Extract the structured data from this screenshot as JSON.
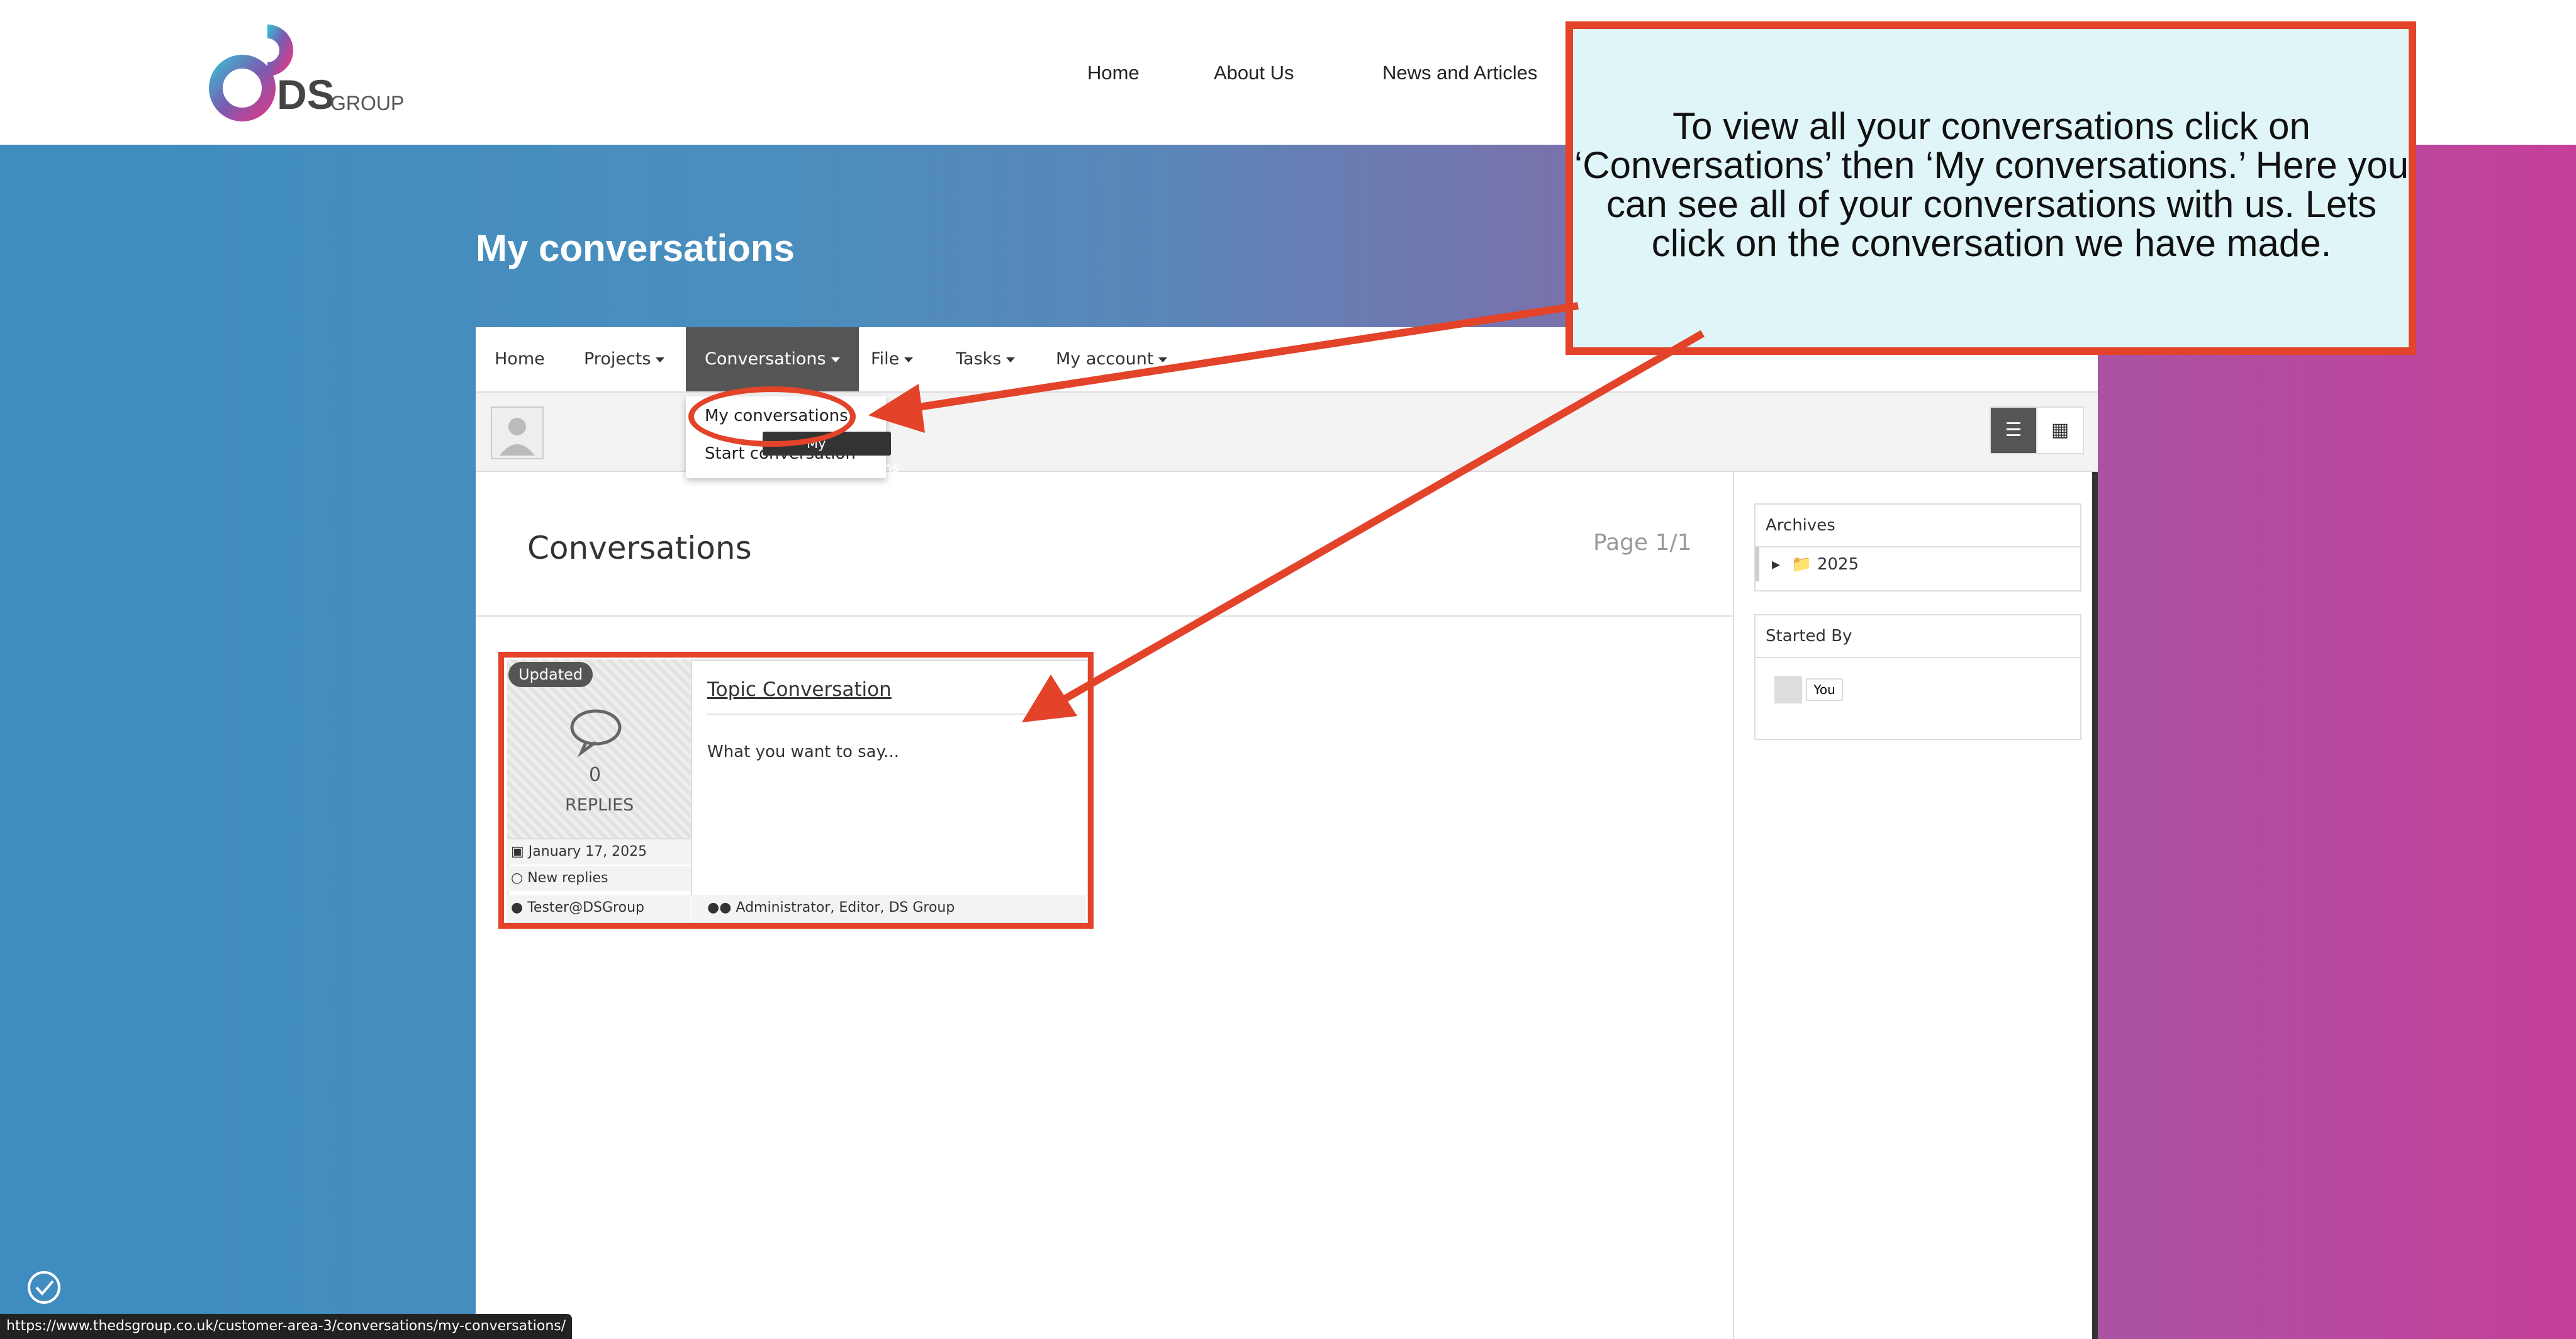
{
  "site": {
    "logo_text": "DS",
    "logo_sub": "GROUP",
    "nav": [
      "Home",
      "About Us",
      "News and Articles"
    ]
  },
  "page_title": "My conversations",
  "menubar": {
    "items": [
      "Home",
      "Projects",
      "Conversations",
      "File",
      "Tasks",
      "My account"
    ],
    "active": "Conversations"
  },
  "dropdown": {
    "items": [
      "My conversations",
      "Start conversation"
    ],
    "tooltip": "My conversations"
  },
  "main": {
    "heading": "Conversations",
    "page_info": "Page 1/1"
  },
  "conversation": {
    "badge": "Updated",
    "replies_count": "0",
    "replies_label": "REPLIES",
    "date": "January 17, 2025",
    "new_replies": "New replies",
    "author": "Tester@DSGroup",
    "title": "Topic Conversation",
    "excerpt": "What you want to say...",
    "participants": "Administrator, Editor, DS Group"
  },
  "sidebar": {
    "archives_title": "Archives",
    "archive_year": "2025",
    "started_by_title": "Started By",
    "started_by_user": "You"
  },
  "annotation": {
    "text": "To view all your conversations click on ‘Conversations’ then ‘My conversations.’ Here you can see all of your conversations with us. Lets click on the conversation we have made."
  },
  "status_bar": {
    "url": "https://www.thedsgroup.co.uk/customer-area-3/conversations/my-conversations/"
  },
  "colors": {
    "annotation_red": "#e24329",
    "annotation_bg": "#e0f5f8",
    "gradient_left": "#3e8cc0",
    "gradient_right": "#c53f9a",
    "active_menu": "#555555"
  }
}
